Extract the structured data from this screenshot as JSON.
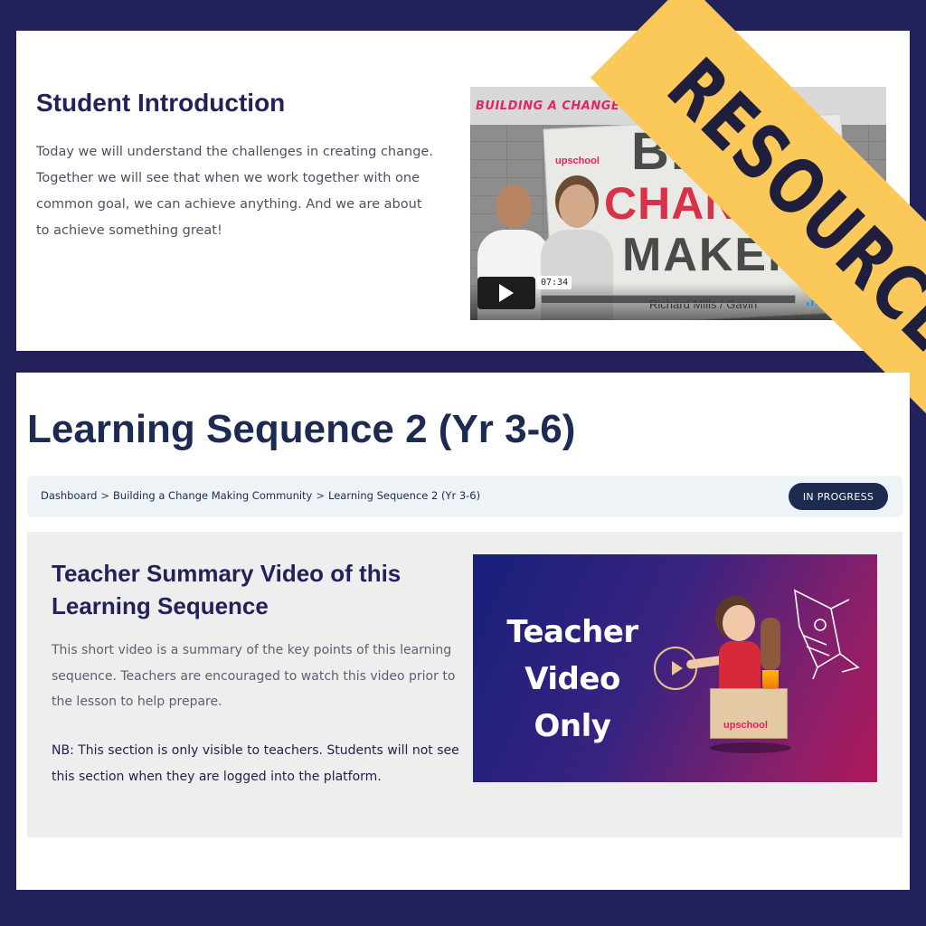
{
  "student": {
    "title": "Student Introduction",
    "body": "Today we will understand the challenges in creating change. Together we will see that when we work together with one common goal, we can achieve anything. And we are about to achieve something great!",
    "video": {
      "banner": "BUILDING A CHANGE MAKING",
      "brand": "upschool",
      "poster_line1": "BE",
      "poster_line2": "CHANGE",
      "poster_line3": "MAKER",
      "duration": "07:34",
      "names": "Richard Mills  /  Gavin"
    }
  },
  "ribbon": {
    "label": "RESOURCES",
    "color": "#fbc95a"
  },
  "sequence": {
    "title": "Learning Sequence 2 (Yr 3-6)",
    "breadcrumbs": [
      "Dashboard",
      "Building a Change Making Community",
      "Learning Sequence 2 (Yr 3-6)"
    ],
    "breadcrumb_sep": ">",
    "status": "IN PROGRESS"
  },
  "teacher": {
    "title": "Teacher Summary Video of this Learning Sequence",
    "body": "This short video is a summary of the key points of this learning sequence. Teachers are encouraged to watch this video prior to the lesson to help prepare.",
    "note": "NB: This section is only visible to teachers. Students will not see this section when they are logged into the platform.",
    "video": {
      "line1": "Teacher",
      "line2": "Video",
      "line3": "Only",
      "brand": "upschool"
    }
  },
  "colors": {
    "frame": "#22215a",
    "heading": "#22225a",
    "pill": "#1c2b4f",
    "brand_pink": "#e0245e"
  }
}
